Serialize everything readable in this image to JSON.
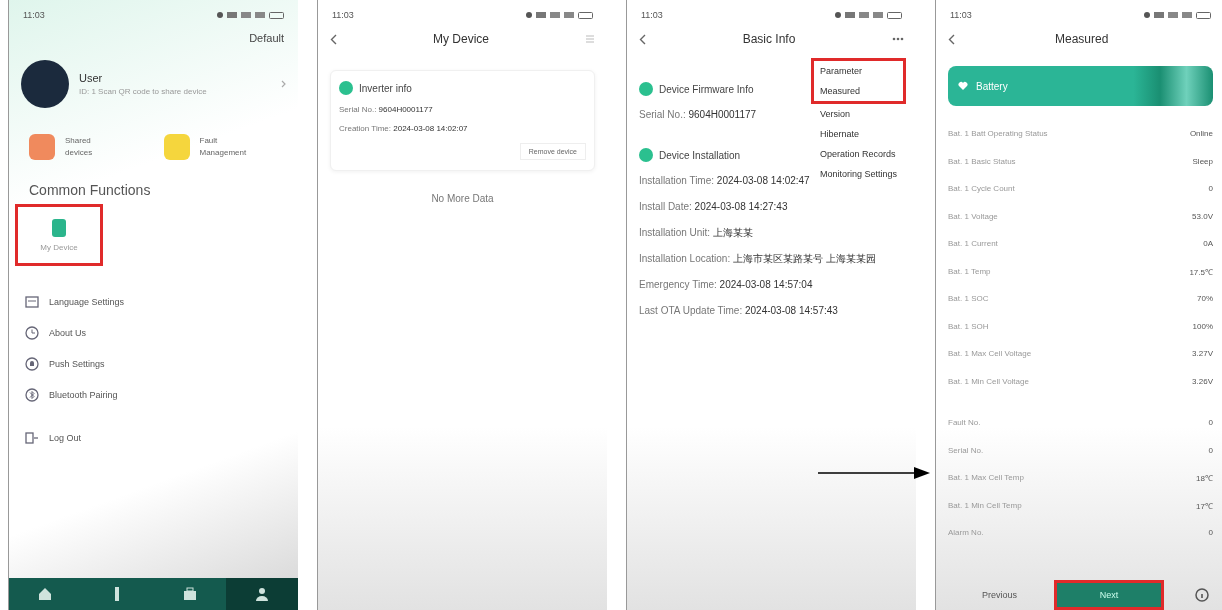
{
  "profile_screen": {
    "status_time": "11:03",
    "top_link": "Default",
    "user": {
      "name": "User",
      "subtitle": "ID: 1 Scan QR code to share device"
    },
    "shortcuts": [
      {
        "line1": "Shared",
        "line2": "devices",
        "color": "#f08a5d"
      },
      {
        "line1": "Fault",
        "line2": "Management",
        "color": "#f5d63d"
      }
    ],
    "section_title": "Common Functions",
    "function_tile": {
      "label": "My Device",
      "highlighted": true
    },
    "menu": [
      {
        "kind": "language",
        "label": "Language Settings"
      },
      {
        "kind": "about",
        "label": "About Us"
      },
      {
        "kind": "push",
        "label": "Push Settings"
      },
      {
        "kind": "bluetooth",
        "label": "Bluetooth Pairing"
      },
      {
        "kind": "logout",
        "label": "Log Out"
      }
    ],
    "nav": [
      {
        "kind": "home",
        "selected": false
      },
      {
        "kind": "device",
        "selected": false
      },
      {
        "kind": "service",
        "selected": false
      },
      {
        "kind": "profile",
        "selected": true
      }
    ]
  },
  "device_screen": {
    "status_time": "11:03",
    "title": "My Device",
    "card": {
      "title": "Inverter info",
      "rows": [
        {
          "label": "Serial No.:",
          "value": "9604H0001177"
        },
        {
          "label": "Creation Time:",
          "value": "2024-03-08 14:02:07"
        }
      ],
      "action": "Remove device"
    },
    "empty_text": "No More Data"
  },
  "info_screen": {
    "status_time": "11:03",
    "title": "Basic Info",
    "sections": [
      {
        "title": "Device Firmware Info",
        "rows": [
          {
            "label": "Serial No.:",
            "value": "9604H0001177"
          }
        ]
      },
      {
        "title": "Device Installation",
        "rows": [
          {
            "label": "Installation Time:",
            "value": "2024-03-08 14:02:47"
          },
          {
            "label": "Install Date:",
            "value": "2024-03-08 14:27:43"
          },
          {
            "label": "Installation Unit:",
            "value": "上海某某"
          },
          {
            "label": "Installation Location:",
            "value": "上海市某区某路某号 上海某某园"
          },
          {
            "label": "Emergency Time:",
            "value": "2024-03-08 14:57:04"
          },
          {
            "label": "Last OTA Update Time:",
            "value": "2024-03-08 14:57:43"
          }
        ]
      }
    ],
    "menu": [
      {
        "label": "Parameter",
        "highlighted": true
      },
      {
        "label": "Measured",
        "highlighted": true
      },
      {
        "label": "Version",
        "highlighted": false
      },
      {
        "label": "Hibernate",
        "highlighted": false
      },
      {
        "label": "Operation Records",
        "highlighted": false
      },
      {
        "label": "Monitoring Settings",
        "highlighted": false
      }
    ]
  },
  "measured_screen": {
    "status_time": "11:03",
    "title": "Measured",
    "banner": "Battery",
    "groups": [
      [
        {
          "label": "Bat. 1 Batt Operating Status",
          "value": "Online"
        },
        {
          "label": "Bat. 1 Basic Status",
          "value": "Sleep"
        },
        {
          "label": "Bat. 1 Cycle Count",
          "value": "0"
        },
        {
          "label": "Bat. 1 Voltage",
          "value": "53.0V"
        },
        {
          "label": "Bat. 1 Current",
          "value": "0A"
        },
        {
          "label": "Bat. 1 Temp",
          "value": "17.5℃"
        },
        {
          "label": "Bat. 1 SOC",
          "value": "70%"
        },
        {
          "label": "Bat. 1 SOH",
          "value": "100%"
        },
        {
          "label": "Bat. 1 Max Cell Voltage",
          "value": "3.27V"
        },
        {
          "label": "Bat. 1 Min Cell Voltage",
          "value": "3.26V"
        }
      ],
      [
        {
          "label": "Fault No.",
          "value": "0"
        },
        {
          "label": "Serial No.",
          "value": "0"
        },
        {
          "label": "Bat. 1 Max Cell Temp",
          "value": "18℃"
        },
        {
          "label": "Bat. 1 Min Cell Temp",
          "value": "17℃"
        },
        {
          "label": "Alarm No.",
          "value": "0"
        }
      ]
    ],
    "footer": {
      "previous": "Previous",
      "next": "Next",
      "next_highlighted": true
    }
  }
}
